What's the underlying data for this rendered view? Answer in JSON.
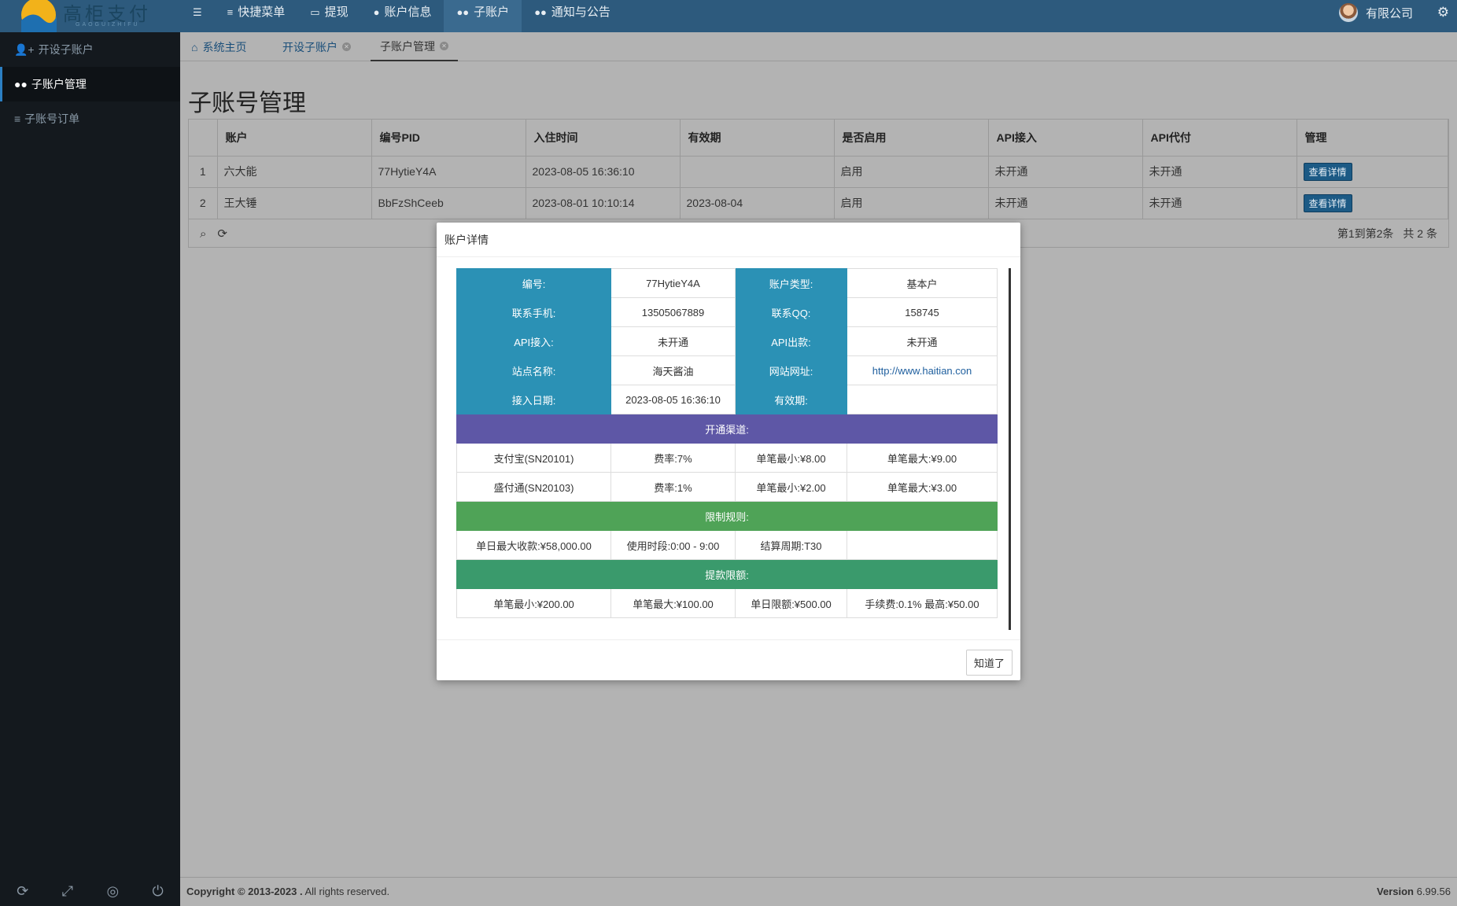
{
  "logo": {
    "text": "高柜支付",
    "sub": "GAOGUIZHIFU"
  },
  "nav": {
    "menu_icon": "hamburger-icon",
    "items": [
      {
        "label": "快捷菜单",
        "icon": "list-icon"
      },
      {
        "label": "提现",
        "icon": "laptop-icon"
      },
      {
        "label": "账户信息",
        "icon": "user-icon"
      },
      {
        "label": "子账户",
        "icon": "users-icon"
      },
      {
        "label": "通知与公告",
        "icon": "users-icon"
      }
    ]
  },
  "user": {
    "name": "有限公司"
  },
  "sidebar": {
    "items": [
      {
        "label": "开设子账户",
        "icon": "user-plus-icon"
      },
      {
        "label": "子账户管理",
        "icon": "users-icon"
      },
      {
        "label": "子账号订单",
        "icon": "list-icon"
      }
    ]
  },
  "tabs": [
    {
      "label": "系统主页",
      "icon": "home-icon"
    },
    {
      "label": "开设子账户"
    },
    {
      "label": "子账户管理"
    }
  ],
  "page": {
    "title": "子账号管理"
  },
  "table": {
    "headers": [
      "账户",
      "编号PID",
      "入住时间",
      "有效期",
      "是否启用",
      "API接入",
      "API代付",
      "管理"
    ],
    "rows": [
      {
        "n": "1",
        "account": "六大能",
        "pid": "77HytieY4A",
        "joined": "2023-08-05 16:36:10",
        "expiry": "",
        "enabled": "启用",
        "api_in": "未开通",
        "api_pay": "未开通",
        "action": "查看详情"
      },
      {
        "n": "2",
        "account": "王大锤",
        "pid": "BbFzShCeeb",
        "joined": "2023-08-01 10:10:14",
        "expiry": "2023-08-04",
        "enabled": "启用",
        "api_in": "未开通",
        "api_pay": "未开通",
        "action": "查看详情"
      }
    ],
    "pager": {
      "range": "第1到第2条",
      "total": "共 2 条"
    }
  },
  "modal": {
    "title": "账户详情",
    "fields": {
      "id_label": "编号:",
      "id": "77HytieY4A",
      "type_label": "账户类型:",
      "type": "基本户",
      "phone_label": "联系手机:",
      "phone": "13505067889",
      "qq_label": "联系QQ:",
      "qq": "158745",
      "api_in_label": "API接入:",
      "api_in": "未开通",
      "api_out_label": "API出款:",
      "api_out": "未开通",
      "site_label": "站点名称:",
      "site": "海天酱油",
      "url_label": "网站网址:",
      "url": "http://www.haitian.con",
      "date_label": "接入日期:",
      "date": "2023-08-05 16:36:10",
      "valid_label": "有效期:",
      "valid": ""
    },
    "channels_title": "开通渠道:",
    "channels": [
      {
        "name": "支付宝(SN20101)",
        "rate": "费率:7%",
        "min": "单笔最小:¥8.00",
        "max": "单笔最大:¥9.00"
      },
      {
        "name": "盛付通(SN20103)",
        "rate": "费率:1%",
        "min": "单笔最小:¥2.00",
        "max": "单笔最大:¥3.00"
      }
    ],
    "rules_title": "限制规则:",
    "rules": {
      "daily": "单日最大收款:¥58,000.00",
      "period": "使用时段:0:00 - 9:00",
      "cycle": "结算周期:T30",
      "extra": ""
    },
    "withdraw_title": "提款限额:",
    "withdraw": {
      "min": "单笔最小:¥200.00",
      "max": "单笔最大:¥100.00",
      "daily": "单日限额:¥500.00",
      "fee": "手续费:0.1% 最高:¥50.00"
    },
    "ok": "知道了"
  },
  "footer": {
    "copyright_bold": "Copyright © 2013-2023 .",
    "copyright_rest": " All rights reserved.",
    "version_label": "Version",
    "version": "6.99.56"
  },
  "colors": {
    "topbar": "#2d5a7d",
    "sidebar": "#14191e",
    "label_blue": "#2b91b5",
    "purple": "#5e57a6",
    "green": "#4fa357",
    "teal": "#3a9a6c"
  }
}
